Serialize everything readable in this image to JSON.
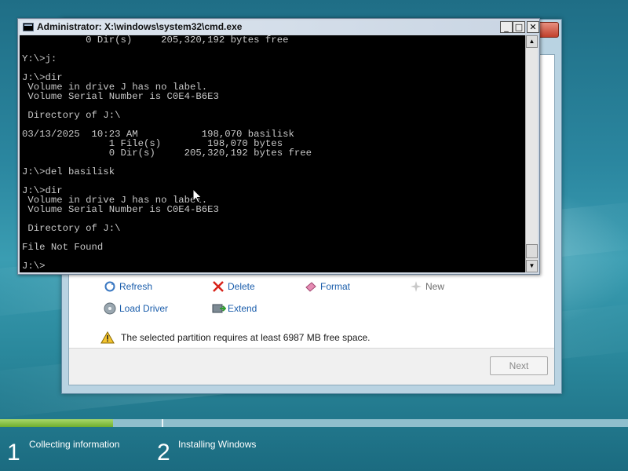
{
  "cmd": {
    "title": "Administrator: X:\\windows\\system32\\cmd.exe",
    "controls": {
      "minimize": "_",
      "maximize": "□",
      "close": "✕"
    },
    "output": "           0 Dir(s)     205,320,192 bytes free\n\nY:\\>j:\n\nJ:\\>dir\n Volume in drive J has no label.\n Volume Serial Number is C0E4-B6E3\n\n Directory of J:\\\n\n03/13/2025  10:23 AM           198,070 basilisk\n               1 File(s)        198,070 bytes\n               0 Dir(s)     205,320,192 bytes free\n\nJ:\\>del basilisk\n\nJ:\\>dir\n Volume in drive J has no label.\n Volume Serial Number is C0E4-B6E3\n\n Directory of J:\\\n\nFile Not Found\n\nJ:\\>"
  },
  "setup": {
    "links": {
      "refresh": "Refresh",
      "delete": "Delete",
      "format": "Format",
      "new": "New",
      "load_driver": "Load Driver",
      "extend": "Extend"
    },
    "warning": "The selected partition requires at least 6987 MB free space.",
    "next": "Next"
  },
  "progress": {
    "fraction": 0.18,
    "steps": [
      {
        "number": "1",
        "label": "Collecting information"
      },
      {
        "number": "2",
        "label": "Installing Windows"
      }
    ]
  },
  "icons": {
    "refresh": "refresh-icon",
    "delete": "delete-icon",
    "format": "format-icon",
    "new": "new-icon",
    "load_driver": "load-driver-icon",
    "extend": "extend-icon",
    "warning": "warning-icon"
  }
}
